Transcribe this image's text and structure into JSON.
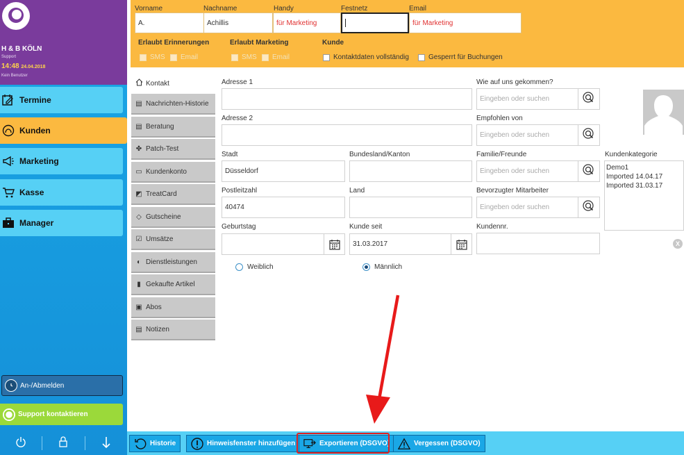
{
  "sidebar": {
    "salon_name": "H & B KÖLN",
    "role": "Support",
    "time": "14:48",
    "date": "24.04.2018",
    "user": "Kein Benutzer",
    "nav": [
      {
        "label": "Termine",
        "icon": "calendar-edit-icon"
      },
      {
        "label": "Kunden",
        "icon": "customers-icon"
      },
      {
        "label": "Marketing",
        "icon": "megaphone-icon"
      },
      {
        "label": "Kasse",
        "icon": "cart-icon"
      },
      {
        "label": "Manager",
        "icon": "briefcase-icon"
      }
    ],
    "login_label": "An-/Abmelden",
    "support_label": "Support kontaktieren"
  },
  "header": {
    "vorname_label": "Vorname",
    "vorname": "A.",
    "nachname_label": "Nachname",
    "nachname": "Achillis",
    "handy_label": "Handy",
    "handy": "für Marketing",
    "festnetz_label": "Festnetz",
    "festnetz": "",
    "email_label": "Email",
    "email": "für Marketing",
    "erinnerungen_title": "Erlaubt Erinnerungen",
    "marketing_title": "Erlaubt Marketing",
    "kunde_title": "Kunde",
    "sms": "SMS",
    "email_opt": "Email",
    "kontaktdaten": "Kontaktdaten vollständig",
    "gesperrt": "Gesperrt für Buchungen"
  },
  "tabs": [
    {
      "label": "Kontakt",
      "icon": "home-icon"
    },
    {
      "label": "Nachrichten-Historie",
      "icon": "document-icon"
    },
    {
      "label": "Beratung",
      "icon": "document-icon"
    },
    {
      "label": "Patch-Test",
      "icon": "patch-icon"
    },
    {
      "label": "Kundenkonto",
      "icon": "card-icon"
    },
    {
      "label": "TreatCard",
      "icon": "treatcard-icon"
    },
    {
      "label": "Gutscheine",
      "icon": "tag-icon"
    },
    {
      "label": "Umsätze",
      "icon": "checklist-icon"
    },
    {
      "label": "Dienstleistungen",
      "icon": "services-icon"
    },
    {
      "label": "Gekaufte Artikel",
      "icon": "bottle-icon"
    },
    {
      "label": "Abos",
      "icon": "subscription-icon"
    },
    {
      "label": "Notizen",
      "icon": "document-icon"
    }
  ],
  "form": {
    "adresse1_label": "Adresse 1",
    "adresse1": "",
    "adresse2_label": "Adresse 2",
    "adresse2": "",
    "stadt_label": "Stadt",
    "stadt": "Düsseldorf",
    "bundesland_label": "Bundesland/Kanton",
    "bundesland": "",
    "plz_label": "Postleitzahl",
    "plz": "40474",
    "land_label": "Land",
    "land": "",
    "geburtstag_label": "Geburtstag",
    "geburtstag": "",
    "kunde_seit_label": "Kunde seit",
    "kunde_seit": "31.03.2017",
    "wie_label": "Wie auf uns gekommen?",
    "empfohlen_label": "Empfohlen von",
    "familie_label": "Familie/Freunde",
    "mitarbeiter_label": "Bevorzugter Mitarbeiter",
    "kundennr_label": "Kundennr.",
    "kundennr": "",
    "search_placeholder": "Eingeben oder suchen",
    "kategorie_label": "Kundenkategorie",
    "kategorien": [
      "Demo1",
      "Imported 14.04.17",
      "Imported 31.03.17"
    ],
    "weiblich": "Weiblich",
    "maennlich": "Männlich",
    "gender_selected": "männlich"
  },
  "bottombar": {
    "historie": "Historie",
    "hinweis": "Hinweisfenster hinzufügen",
    "export": "Exportieren (DSGVO)",
    "vergessen": "Vergessen (DSGVO)"
  },
  "colors": {
    "sidebar_blue": "#1aa7e6",
    "nav_blue": "#56d0f5",
    "accent_orange": "#fbb940",
    "brand_purple": "#7a3b9c",
    "support_green": "#9bd93a",
    "highlight_red": "#e02020"
  }
}
